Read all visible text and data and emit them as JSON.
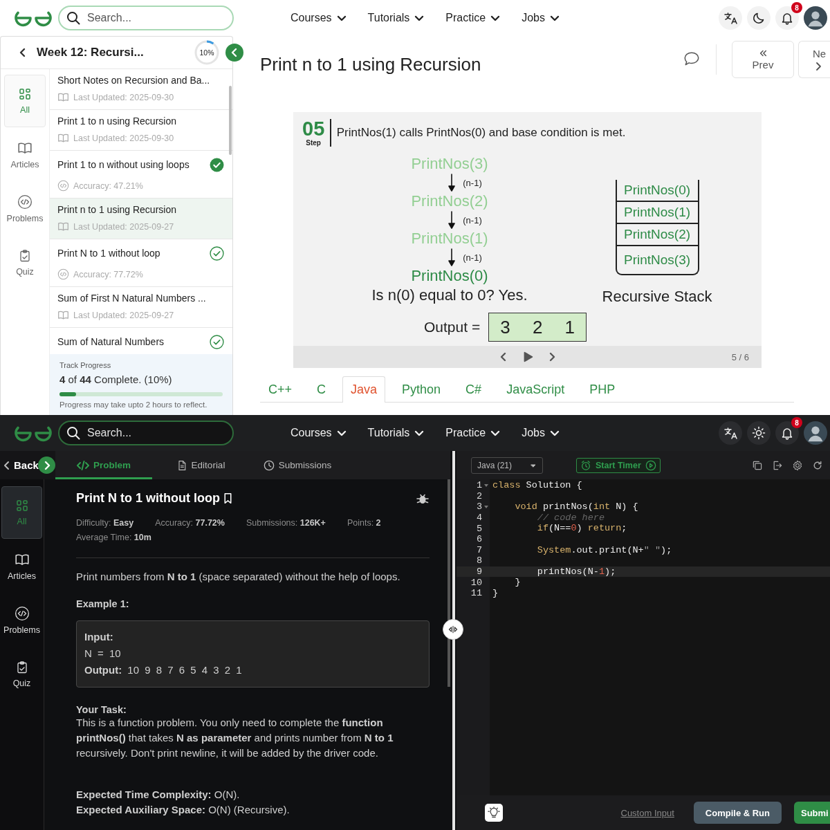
{
  "light_screen": {
    "dark_mode": false,
    "header": {
      "search": {
        "placeholder": "Search..."
      },
      "nav": [
        "Courses",
        "Tutorials",
        "Practice",
        "Jobs"
      ],
      "notifications": "8"
    },
    "sidebar": {
      "title": "Week 12: Recursi...",
      "progress": {
        "text": "10%"
      },
      "rail": [
        {
          "label": "All",
          "kind": "all",
          "selected": true
        },
        {
          "label": "Articles",
          "kind": "articles",
          "selected": false
        },
        {
          "label": "Problems",
          "kind": "problems",
          "selected": false
        },
        {
          "label": "Quiz",
          "kind": "quiz",
          "selected": false
        }
      ],
      "items": [
        {
          "title": "Short Notes on Recursion and Ba...",
          "meta": "Last Updated: 2025-09-30",
          "kind": "article",
          "selected": false
        },
        {
          "title": "Print 1 to n using Recursion",
          "meta": "Last Updated: 2025-09-30",
          "kind": "article",
          "selected": false
        },
        {
          "title": "Print 1 to n without using loops",
          "meta": "Accuracy: 47.21%",
          "kind": "problem",
          "solved": true,
          "selected": false
        },
        {
          "title": "Print n to 1 using Recursion",
          "meta": "Last Updated: 2025-09-27",
          "kind": "article",
          "selected": true
        },
        {
          "title": "Print N to 1 without loop",
          "meta": "Accuracy: 77.72%",
          "kind": "problem",
          "solved": false,
          "selected": false
        },
        {
          "title": "Sum of First N Natural Numbers ...",
          "meta": "Last Updated: 2025-09-27",
          "kind": "article",
          "selected": false
        },
        {
          "title": "Sum of Natural Numbers",
          "kind": "problem",
          "solved": false,
          "selected": false
        }
      ],
      "track": {
        "label": "Track Progress",
        "summary": "**4** of **44** Complete. (10%)",
        "level": 0.1,
        "note": "Progress may take upto 2 hours to reflect."
      }
    },
    "article": {
      "title": "Print n to 1 using Recursion",
      "prev": "Prev",
      "next": "Ne",
      "slide": {
        "step": "05",
        "step_label": "Step",
        "caption": "PrintNos(1) calls PrintNos(0) and base condition is met.",
        "calls": [
          {
            "text": "PrintNos(3)",
            "active": false
          },
          {
            "text": "PrintNos(2)",
            "active": false
          },
          {
            "text": "PrintNos(1)",
            "active": false
          },
          {
            "text": "PrintNos(0)",
            "active": true
          }
        ],
        "arrow_labels": [
          "(n-1)",
          "(n-1)",
          "(n-1)"
        ],
        "question": "Is n(0) equal to 0? Yes.",
        "output_label": "Output =",
        "output": [
          "3",
          "2",
          "1"
        ],
        "stack": [
          "PrintNos(0)",
          "PrintNos(1)",
          "PrintNos(2)",
          "PrintNos(3)"
        ],
        "stack_label": "Recursive Stack",
        "counter": "5 / 6"
      },
      "tabs": [
        {
          "label": "C++",
          "selected": false
        },
        {
          "label": "C",
          "selected": false
        },
        {
          "label": "Java",
          "selected": true
        },
        {
          "label": "Python",
          "selected": false
        },
        {
          "label": "C#",
          "selected": false
        },
        {
          "label": "JavaScript",
          "selected": false
        },
        {
          "label": "PHP",
          "selected": false
        }
      ]
    }
  },
  "dark_screen": {
    "dark_mode": true,
    "header": {
      "search": {
        "placeholder": "Search..."
      },
      "nav": [
        "Courses",
        "Tutorials",
        "Practice",
        "Jobs"
      ],
      "notifications": "8"
    },
    "back": "Back",
    "tabs": [
      {
        "label": "Problem",
        "kind": "problem",
        "selected": true
      },
      {
        "label": "Editorial",
        "kind": "editorial",
        "selected": false
      },
      {
        "label": "Submissions",
        "kind": "submissions",
        "selected": false
      }
    ],
    "rail": [
      {
        "label": "All",
        "kind": "all",
        "selected": true
      },
      {
        "label": "Articles",
        "kind": "articles",
        "selected": false
      },
      {
        "label": "Problems",
        "kind": "problems",
        "selected": false
      },
      {
        "label": "Quiz",
        "kind": "quiz",
        "selected": false
      }
    ],
    "problem": {
      "title": "Print N to 1 without loop",
      "meta": [
        "Difficulty: **Easy**",
        "Accuracy: **77.72%**",
        "Submissions: **126K+**",
        "Points: **2**",
        "Average Time: **10m**"
      ],
      "statement": "Print numbers from **N to 1** (space separated) without the help of loops.",
      "example_heading": "Example 1:",
      "example": {
        "input_label": "Input:",
        "input": "N = 10",
        "output": "**Output:** 10 9 8 7 6 5 4 3 2 1"
      },
      "task_heading": "Your Task:",
      "task": "This is a function problem. You only need to complete the **function printNos()** that takes **N as parameter** and prints number from **N to 1** recursively. Don't print newline, it will be added by the driver code.",
      "complexity": [
        "**Expected Time Complexity:** O(N).",
        "**Expected Auxiliary Space:** O(N) (Recursive)."
      ]
    },
    "editor": {
      "language": "Java (21)",
      "timer": "Start Timer",
      "lines": [
        {
          "number": "1",
          "fold": true,
          "active": false,
          "tokens": [
            {
              "kind": "keyword",
              "text": "class"
            },
            {
              "kind": "plain",
              "text": " Solution {"
            }
          ],
          "children": [
            {
              "number": "2",
              "fold": false,
              "active": false
            },
            {
              "number": "3",
              "fold": true,
              "active": false,
              "tokens": [
                {
                  "kind": "keyword",
                  "text": "void"
                },
                {
                  "kind": "plain",
                  "text": " printNos("
                },
                {
                  "kind": "keyword",
                  "text": "int"
                },
                {
                  "kind": "plain",
                  "text": " N) {"
                }
              ],
              "children": [
                {
                  "number": "4",
                  "fold": false,
                  "active": false,
                  "tokens": [
                    {
                      "kind": "comment",
                      "text": "// code here"
                    }
                  ]
                },
                {
                  "number": "5",
                  "fold": false,
                  "active": false,
                  "tokens": [
                    {
                      "kind": "keyword",
                      "text": "if"
                    },
                    {
                      "kind": "plain",
                      "text": "(N=="
                    },
                    {
                      "kind": "number",
                      "text": "0"
                    },
                    {
                      "kind": "plain",
                      "text": ") "
                    },
                    {
                      "kind": "keyword",
                      "text": "return"
                    },
                    {
                      "kind": "plain",
                      "text": ";"
                    }
                  ]
                },
                {
                  "number": "6",
                  "fold": false,
                  "active": false
                },
                {
                  "number": "7",
                  "fold": false,
                  "active": false,
                  "tokens": [
                    {
                      "kind": "keyword",
                      "text": "System"
                    },
                    {
                      "kind": "plain",
                      "text": ".out.print(N+"
                    },
                    {
                      "kind": "string",
                      "text": "\" \""
                    },
                    {
                      "kind": "plain",
                      "text": ");"
                    }
                  ]
                },
                {
                  "number": "8",
                  "fold": false,
                  "active": false
                },
                {
                  "number": "9",
                  "fold": false,
                  "active": true,
                  "tokens": [
                    {
                      "kind": "plain",
                      "text": "printNos(N-"
                    },
                    {
                      "kind": "number",
                      "text": "1"
                    },
                    {
                      "kind": "plain",
                      "text": ");"
                    }
                  ]
                }
              ]
            },
            {
              "number": "10",
              "fold": false,
              "active": false,
              "tokens": [
                {
                  "kind": "plain",
                  "text": "}"
                }
              ]
            }
          ]
        },
        {
          "number": "11",
          "fold": false,
          "active": false,
          "tokens": [
            {
              "kind": "plain",
              "text": "}"
            }
          ]
        }
      ],
      "custom_input": "Custom Input",
      "compile": "Compile & Run",
      "submit": "Submi"
    }
  }
}
